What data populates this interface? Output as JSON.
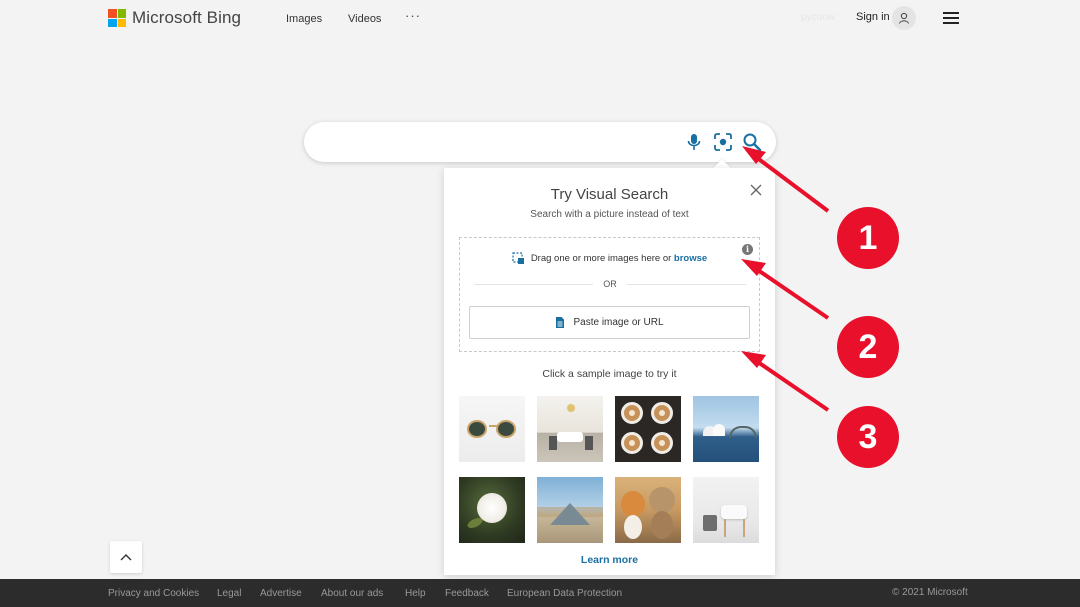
{
  "header": {
    "brand": "Microsoft Bing",
    "nav": [
      {
        "label": "Images"
      },
      {
        "label": "Videos"
      }
    ],
    "more_label": "···",
    "user_name": "pycoow",
    "sign_in_label": "Sign in"
  },
  "search": {
    "placeholder": "",
    "mic_icon": "microphone-icon",
    "visual_icon": "visual-search-icon",
    "search_icon": "search-icon"
  },
  "visual_search": {
    "title": "Try Visual Search",
    "subtitle": "Search with a picture instead of text",
    "drag_text": "Drag one or more images here or ",
    "browse_label": "browse",
    "or_label": "OR",
    "paste_label": "Paste image or URL",
    "sample_label": "Click a sample image to try it",
    "samples": [
      {
        "subject": "sunglasses"
      },
      {
        "subject": "dining room"
      },
      {
        "subject": "latte art coffee"
      },
      {
        "subject": "sydney opera house"
      },
      {
        "subject": "white rose"
      },
      {
        "subject": "louvre pyramid"
      },
      {
        "subject": "dogs"
      },
      {
        "subject": "white chair"
      }
    ],
    "learn_more_label": "Learn more"
  },
  "annotations": [
    {
      "number": "1"
    },
    {
      "number": "2"
    },
    {
      "number": "3"
    }
  ],
  "footer": {
    "links": [
      "Privacy and Cookies",
      "Legal",
      "Advertise",
      "About our ads",
      "Help",
      "Feedback",
      "European Data Protection"
    ],
    "copyright": "© 2021 Microsoft"
  },
  "colors": {
    "accent": "#1a6fa1",
    "annotation_red": "#e8102a",
    "footer_bg": "#2c2c2c",
    "page_bg": "#f3f3f3"
  }
}
